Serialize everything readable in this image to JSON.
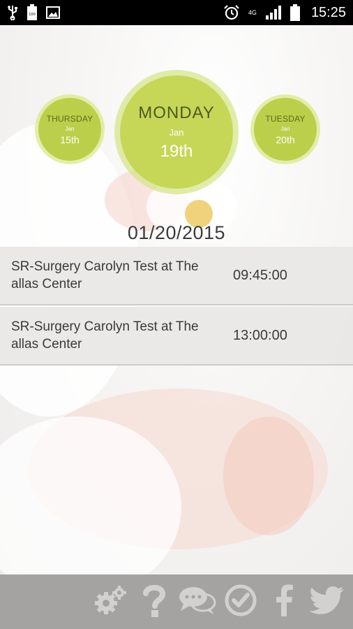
{
  "status_bar": {
    "time": "15:25",
    "network": "4G",
    "icons": [
      "usb-icon",
      "battery-saver-icon",
      "image-icon",
      "alarm-icon",
      "signal-icon",
      "battery-icon"
    ]
  },
  "dates": {
    "prev": {
      "weekday": "THURSDAY",
      "month": "Jan",
      "day": "15th"
    },
    "current": {
      "weekday": "MONDAY",
      "month": "Jan",
      "day": "19th"
    },
    "next": {
      "weekday": "TUESDAY",
      "month": "Jan",
      "day": "20th"
    }
  },
  "selected_date": "01/20/2015",
  "appointments": [
    {
      "title": "SR-Surgery Carolyn Test at The allas Center",
      "time": "09:45:00"
    },
    {
      "title": "SR-Surgery Carolyn Test at The allas Center",
      "time": "13:00:00"
    }
  ],
  "toolbar": {
    "buttons": [
      "settings-icon",
      "help-icon",
      "chat-icon",
      "check-icon",
      "facebook-icon",
      "twitter-icon"
    ]
  },
  "colors": {
    "accent_green": "#c6d757",
    "toolbar_gray": "#a5a3a1",
    "icon_gray": "#d3d1cf"
  }
}
